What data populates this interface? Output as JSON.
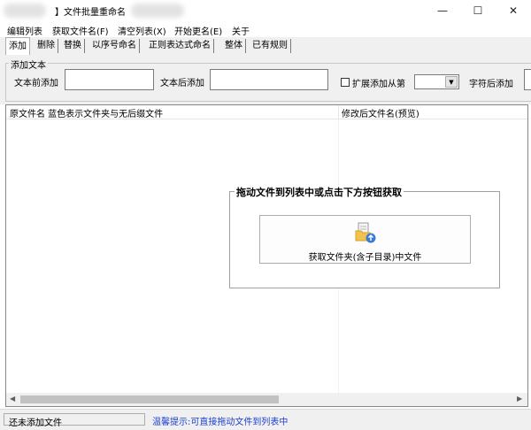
{
  "window": {
    "title": "】文件批量重命名",
    "minimize_glyph": "—",
    "maximize_glyph": "☐",
    "close_glyph": "✕"
  },
  "menu": [
    {
      "label": "编辑列表"
    },
    {
      "label": "获取文件名(F)"
    },
    {
      "label": "清空列表(X)"
    },
    {
      "label": "开始更名(E)"
    },
    {
      "label": "关于"
    }
  ],
  "tabs": [
    {
      "label": "添加",
      "active": true
    },
    {
      "label": "删除"
    },
    {
      "label": "替换"
    },
    {
      "label": "以序号命名"
    },
    {
      "label": "正则表达式命名"
    },
    {
      "label": "整体"
    },
    {
      "label": "已有规则"
    }
  ],
  "add_text": {
    "group_title": "添加文本",
    "prefix_label": "文本前添加",
    "prefix_value": "",
    "suffix_label": "文本后添加",
    "suffix_value": "",
    "extend_checkbox_label": "扩展添加从第",
    "extend_checked": false,
    "position_value": "",
    "after_char_label": "字符后添加"
  },
  "list": {
    "col_original": "原文件名 蓝色表示文件夹与无后缀文件",
    "col_preview": "修改后文件名(预览)",
    "rows": []
  },
  "drag": {
    "title": "拖动文件到列表中或点击下方按钮获取",
    "button_label": "获取文件夹(含子目录)中文件",
    "icon": "folder-add-icon"
  },
  "status": {
    "left_text": "还未添加文件",
    "tip_text": "温馨提示:可直接拖动文件到列表中"
  },
  "colors": {
    "tip": "#1a3fd0",
    "panel_bg": "#f0f0f0"
  }
}
